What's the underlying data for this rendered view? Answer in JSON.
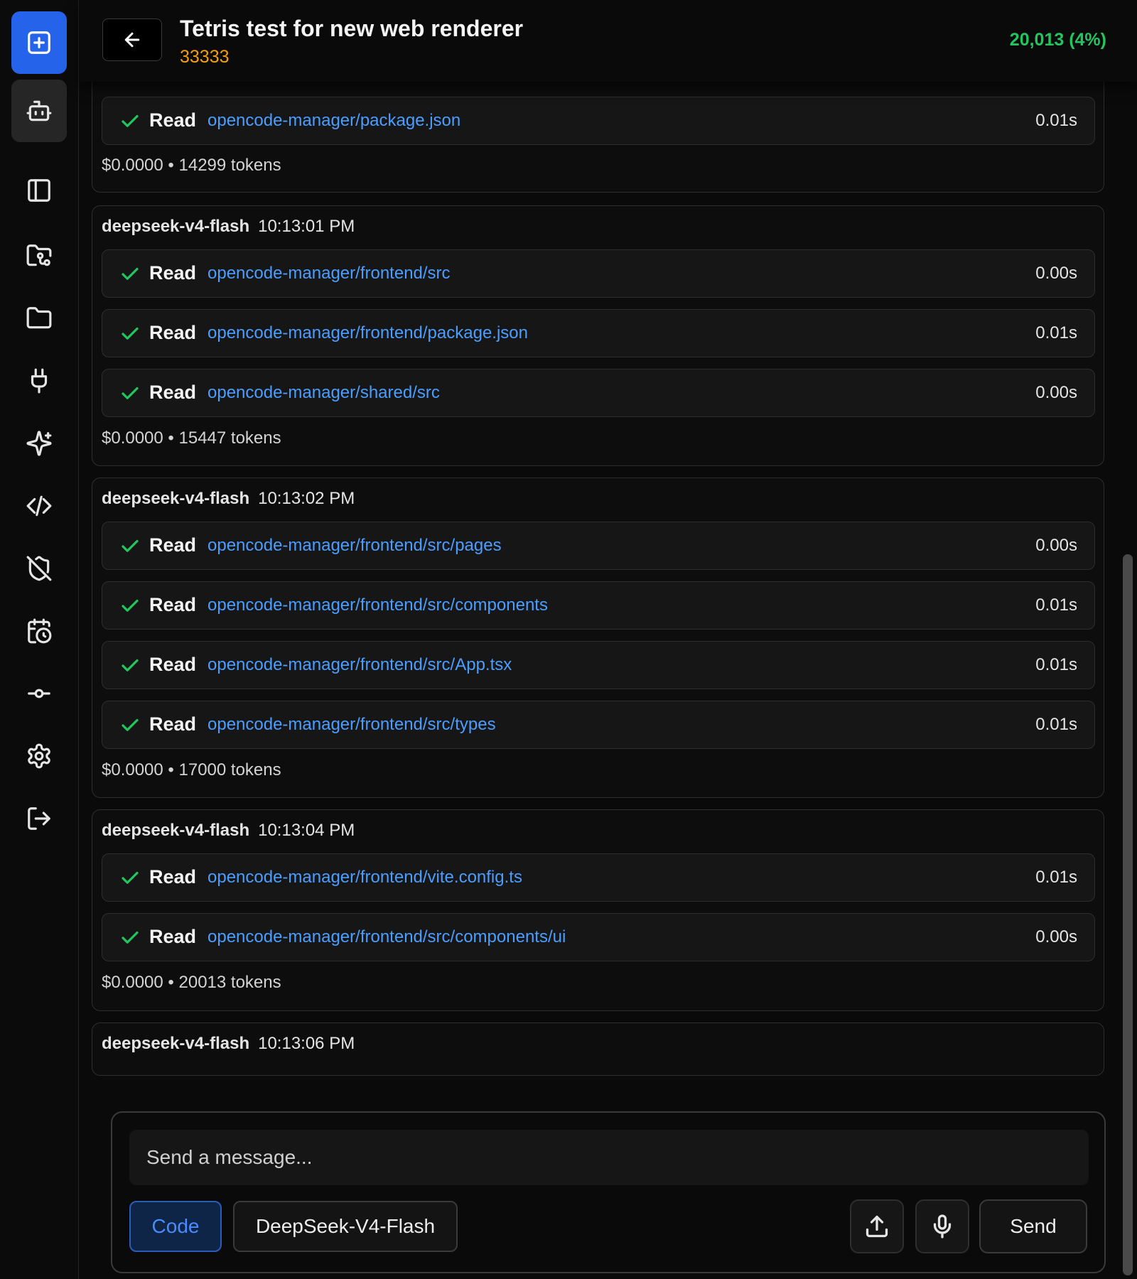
{
  "header": {
    "title": "Tetris test for new web renderer",
    "subtitle": "33333",
    "usage": "20,013 (4%)"
  },
  "sidebar": {
    "items": [
      {
        "icon": "new-session-icon"
      },
      {
        "icon": "bot-icon"
      },
      {
        "icon": "panel-left-icon"
      },
      {
        "icon": "folder-git-icon"
      },
      {
        "icon": "folder-icon"
      },
      {
        "icon": "plug-icon"
      },
      {
        "icon": "sparkles-icon"
      },
      {
        "icon": "code-icon"
      },
      {
        "icon": "shield-off-icon"
      },
      {
        "icon": "calendar-clock-icon"
      },
      {
        "icon": "git-commit-icon"
      },
      {
        "icon": "gear-icon"
      },
      {
        "icon": "logout-icon"
      }
    ]
  },
  "messages": [
    {
      "tools": [
        {
          "verb": "Read",
          "path": "opencode-manager/package.json",
          "duration": "0.01s"
        }
      ],
      "footer": "$0.0000 • 14299 tokens"
    },
    {
      "model": "deepseek-v4-flash",
      "time": "10:13:01 PM",
      "tools": [
        {
          "verb": "Read",
          "path": "opencode-manager/frontend/src",
          "duration": "0.00s"
        },
        {
          "verb": "Read",
          "path": "opencode-manager/frontend/package.json",
          "duration": "0.01s"
        },
        {
          "verb": "Read",
          "path": "opencode-manager/shared/src",
          "duration": "0.00s"
        }
      ],
      "footer": "$0.0000 • 15447 tokens"
    },
    {
      "model": "deepseek-v4-flash",
      "time": "10:13:02 PM",
      "tools": [
        {
          "verb": "Read",
          "path": "opencode-manager/frontend/src/pages",
          "duration": "0.00s"
        },
        {
          "verb": "Read",
          "path": "opencode-manager/frontend/src/components",
          "duration": "0.01s"
        },
        {
          "verb": "Read",
          "path": "opencode-manager/frontend/src/App.tsx",
          "duration": "0.01s"
        },
        {
          "verb": "Read",
          "path": "opencode-manager/frontend/src/types",
          "duration": "0.01s"
        }
      ],
      "footer": "$0.0000 • 17000 tokens"
    },
    {
      "model": "deepseek-v4-flash",
      "time": "10:13:04 PM",
      "tools": [
        {
          "verb": "Read",
          "path": "opencode-manager/frontend/vite.config.ts",
          "duration": "0.01s"
        },
        {
          "verb": "Read",
          "path": "opencode-manager/frontend/src/components/ui",
          "duration": "0.00s"
        }
      ],
      "footer": "$0.0000 • 20013 tokens"
    },
    {
      "model": "deepseek-v4-flash",
      "time": "10:13:06 PM"
    }
  ],
  "composer": {
    "placeholder": "Send a message...",
    "mode": "Code",
    "model": "DeepSeek-V4-Flash",
    "send": "Send"
  },
  "colors": {
    "accent": "#2563eb",
    "success": "#22c55e",
    "link": "#4a9eff",
    "warning": "#f59e0b"
  }
}
